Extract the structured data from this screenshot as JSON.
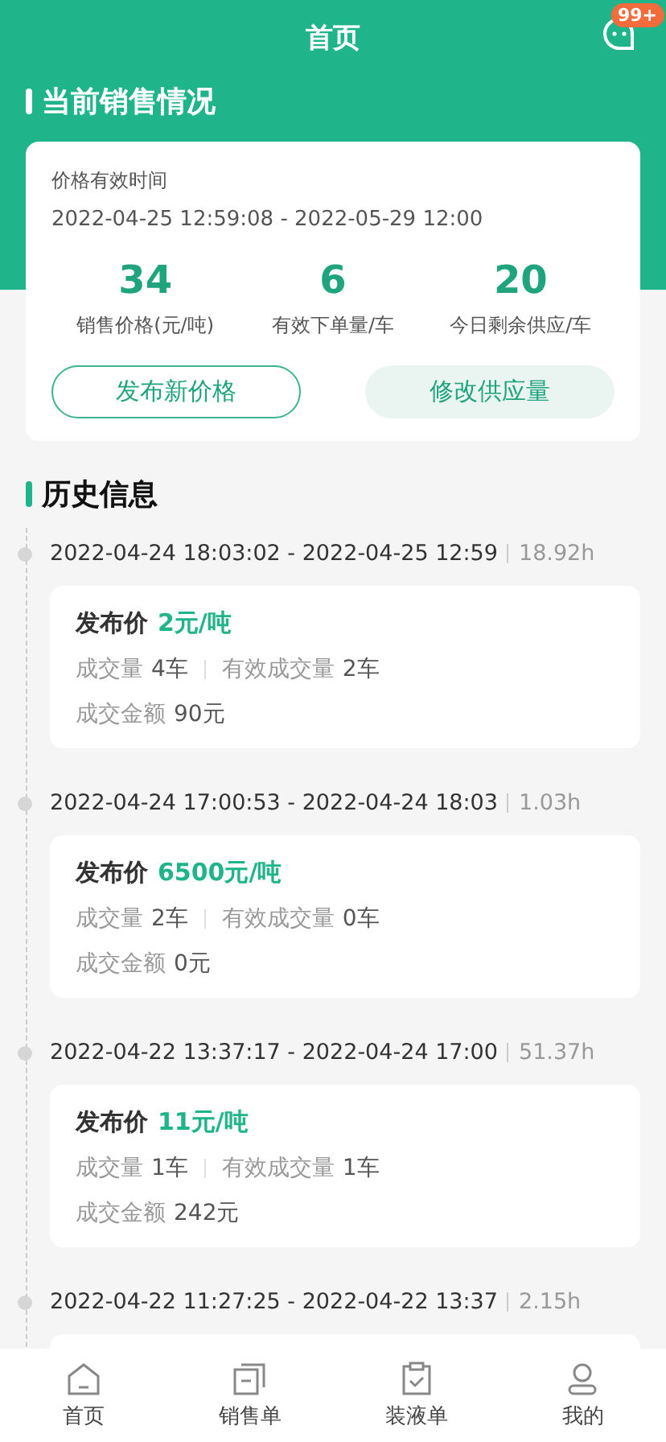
{
  "header": {
    "title": "首页",
    "badge": "99+"
  },
  "current": {
    "title": "当前销售情况",
    "validity_label": "价格有效时间",
    "validity": "2022-04-25 12:59:08 - 2022-05-29 12:00",
    "stats": [
      {
        "value": "34",
        "label": "销售价格(元/吨)"
      },
      {
        "value": "6",
        "label": "有效下单量/车"
      },
      {
        "value": "20",
        "label": "今日剩余供应/车"
      }
    ],
    "buttons": [
      {
        "label": "发布新价格",
        "kind": "outline"
      },
      {
        "label": "修改供应量",
        "kind": "soft"
      }
    ]
  },
  "history": {
    "title": "历史信息",
    "entries": [
      {
        "period": "2022-04-24 18:03:02 - 2022-04-25 12:59",
        "duration": "18.92h",
        "price_label": "发布价",
        "price": "2元/吨",
        "deals_label": "成交量",
        "deals": "4车",
        "valid_label": "有效成交量",
        "valid": "2车",
        "amount_label": "成交金额",
        "amount": "90元"
      },
      {
        "period": "2022-04-24 17:00:53 - 2022-04-24 18:03",
        "duration": "1.03h",
        "price_label": "发布价",
        "price": "6500元/吨",
        "deals_label": "成交量",
        "deals": "2车",
        "valid_label": "有效成交量",
        "valid": "0车",
        "amount_label": "成交金额",
        "amount": "0元"
      },
      {
        "period": "2022-04-22 13:37:17 - 2022-04-24 17:00",
        "duration": "51.37h",
        "price_label": "发布价",
        "price": "11元/吨",
        "deals_label": "成交量",
        "deals": "1车",
        "valid_label": "有效成交量",
        "valid": "1车",
        "amount_label": "成交金额",
        "amount": "242元"
      },
      {
        "period": "2022-04-22 11:27:25 - 2022-04-22 13:37",
        "duration": "2.15h"
      }
    ]
  },
  "tabbar": [
    {
      "label": "首页"
    },
    {
      "label": "销售单"
    },
    {
      "label": "装液单"
    },
    {
      "label": "我的"
    }
  ]
}
